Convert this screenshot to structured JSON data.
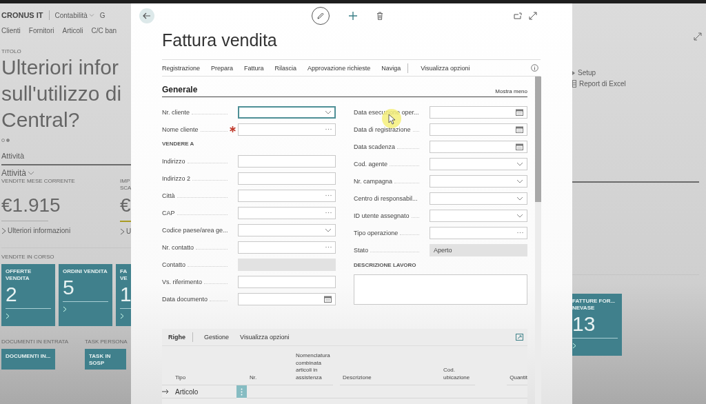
{
  "background": {
    "left": {
      "company": "CRONUS IT",
      "nav_menus": [
        "Contabilità",
        "G"
      ],
      "nav_links": [
        "Clienti",
        "Fornitori",
        "Articoli",
        "C/C ban"
      ],
      "headline_label": "TITOLO",
      "headline_lines": [
        "Ulteriori infor",
        "sull'utilizzo di",
        "Central?"
      ],
      "carousel_dots": [
        {
          "selected": false
        },
        {
          "selected": true
        }
      ],
      "section_tab": "Attività",
      "group": "Attività",
      "kpis": [
        {
          "label": "VENDITE MESE CORRENTE",
          "value": "€1.915",
          "link": "Ulteriori informazioni"
        },
        {
          "label": "IMP SCA",
          "value": "€",
          "link": "U"
        }
      ],
      "tile_group": "VENDITE IN CORSO",
      "tiles": [
        {
          "title": "OFFERTE VENDITA",
          "count": "2"
        },
        {
          "title": "ORDINI VENDITA",
          "count": "5"
        },
        {
          "title": "FA VE",
          "count": "1"
        }
      ],
      "bottom_groups": [
        {
          "title": "DOCUMENTI IN ENTRATA",
          "tile": "DOCUMENTI IN..."
        },
        {
          "title": "TASK PERSONA",
          "tile": "TASK IN SOSP"
        }
      ]
    },
    "right": {
      "actions": [
        {
          "kind": "caret",
          "label": "Setup"
        },
        {
          "kind": "sheet",
          "label": "Report di Excel"
        }
      ],
      "tile": {
        "title": "FATTURE FOR... NEVASE",
        "count": "13"
      }
    }
  },
  "dialog": {
    "title": "Fattura vendita",
    "actions": [
      "Registrazione",
      "Prepara",
      "Fattura",
      "Rilascia",
      "Approvazione richieste",
      "Naviga"
    ],
    "options": "Visualizza opzioni",
    "section": {
      "title": "Generale",
      "toggle": "Mostra meno",
      "left": [
        {
          "kind": "dropdown",
          "label": "Nr. cliente",
          "focused": true,
          "required": false
        },
        {
          "kind": "lookup",
          "label": "Nome cliente",
          "focused": false,
          "required": true
        },
        {
          "kind": "heading",
          "label": "VENDERE A"
        },
        {
          "kind": "text",
          "label": "Indirizzo",
          "focused": false,
          "required": false
        },
        {
          "kind": "text",
          "label": "Indirizzo 2",
          "focused": false,
          "required": false
        },
        {
          "kind": "lookup",
          "label": "Città",
          "focused": false,
          "required": false
        },
        {
          "kind": "lookup",
          "label": "CAP",
          "focused": false,
          "required": false
        },
        {
          "kind": "dropdown",
          "label": "Codice paese/area ge...",
          "focused": false,
          "required": false
        },
        {
          "kind": "lookup",
          "label": "Nr. contatto",
          "focused": false,
          "required": false
        },
        {
          "kind": "readonly",
          "label": "Contatto",
          "focused": false,
          "required": false
        },
        {
          "kind": "text",
          "label": "Vs. riferimento",
          "focused": false,
          "required": false
        },
        {
          "kind": "date",
          "label": "Data documento",
          "focused": false,
          "required": false
        }
      ],
      "right": [
        {
          "kind": "date",
          "label": "Data esecuzione oper...",
          "focused": false,
          "required": false
        },
        {
          "kind": "date",
          "label": "Data di registrazione",
          "focused": false,
          "required": false
        },
        {
          "kind": "date",
          "label": "Data scadenza",
          "focused": false,
          "required": false
        },
        {
          "kind": "dropdown",
          "label": "Cod. agente",
          "focused": false,
          "required": false
        },
        {
          "kind": "dropdown",
          "label": "Nr. campagna",
          "focused": false,
          "required": false
        },
        {
          "kind": "dropdown",
          "label": "Centro di responsabil...",
          "focused": false,
          "required": false
        },
        {
          "kind": "dropdown",
          "label": "ID utente assegnato",
          "focused": false,
          "required": false
        },
        {
          "kind": "lookup",
          "label": "Tipo operazione",
          "focused": false,
          "required": false
        },
        {
          "kind": "readonly",
          "label": "Stato",
          "value": "Aperto",
          "focused": false,
          "required": false
        },
        {
          "kind": "heading",
          "label": "DESCRIZIONE LAVORO"
        },
        {
          "kind": "textarea"
        }
      ]
    },
    "lines": {
      "tabs": [
        {
          "label": "Righe",
          "selected": true
        },
        {
          "label": "Gestione",
          "selected": false
        },
        {
          "label": "Visualizza opzioni",
          "selected": false
        }
      ],
      "columns": [
        "Tipo",
        "Nr.",
        "Nomenclatura combinata articoli in assistenza",
        "Descrizione",
        "Cod. ubicazione",
        "Quantit"
      ],
      "rows": [
        {
          "type": "Articolo",
          "current": true
        }
      ]
    }
  }
}
